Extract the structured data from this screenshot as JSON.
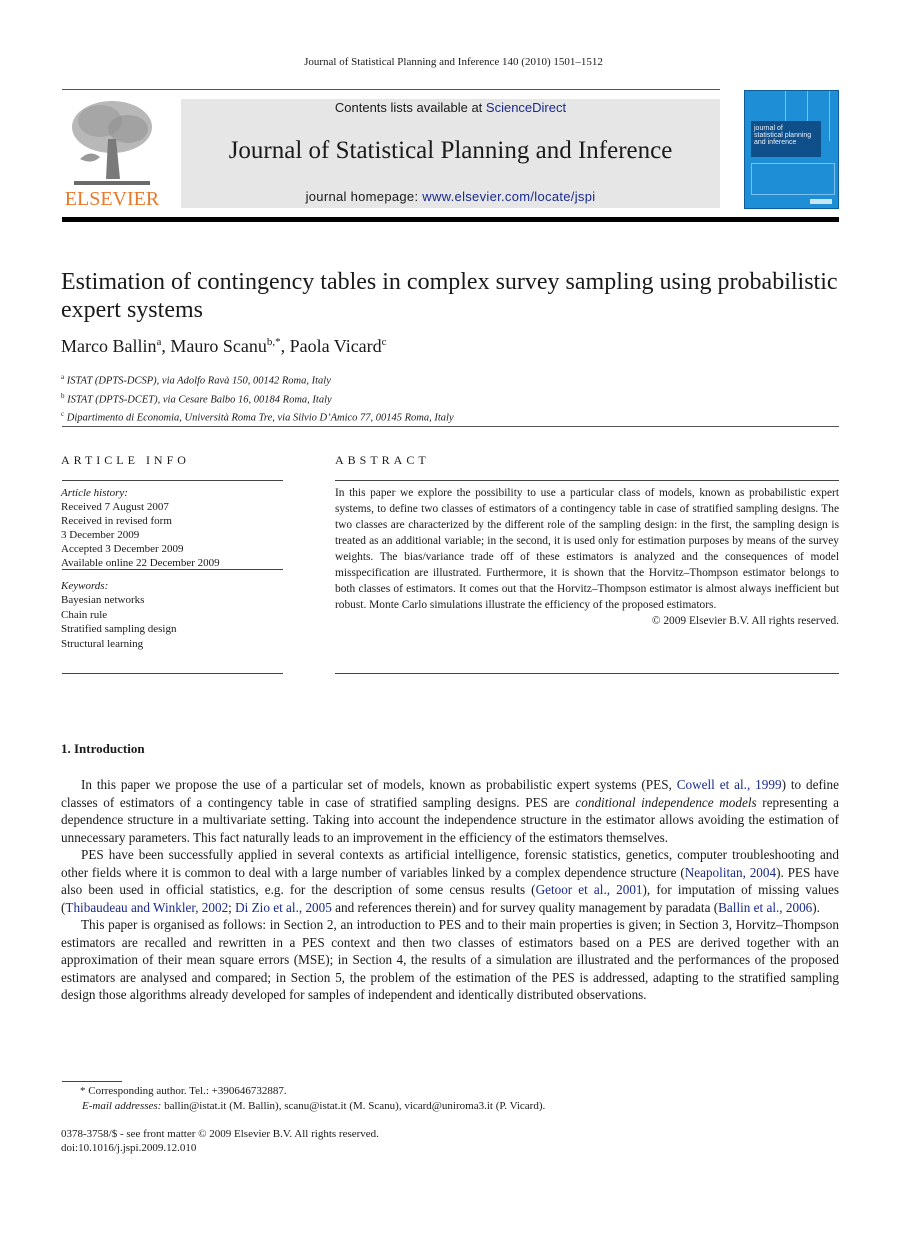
{
  "running_head": "Journal of Statistical Planning and Inference 140 (2010) 1501–1512",
  "masthead": {
    "publisher_logo_text": "ELSEVIER",
    "contents_prefix": "Contents lists available at ",
    "contents_link": "ScienceDirect",
    "journal_title": "Journal of Statistical Planning and Inference",
    "homepage_prefix": "journal homepage: ",
    "homepage_link": "www.elsevier.com/locate/jspi",
    "cover_text": [
      "journal of",
      "statistical planning",
      "and inference"
    ],
    "brand_colors": {
      "elsevier_orange": "#e8792b",
      "cover_blue": "#1e8fd6",
      "link_blue": "#1a2a8a"
    }
  },
  "article": {
    "title": "Estimation of contingency tables in complex survey sampling using probabilistic expert systems",
    "authors": [
      {
        "name": "Marco Ballin",
        "sup": "a"
      },
      {
        "name": "Mauro Scanu",
        "sup": "b,*"
      },
      {
        "name": "Paola Vicard",
        "sup": "c"
      }
    ],
    "affiliations": [
      {
        "sup": "a",
        "text": "ISTAT (DPTS-DCSP), via Adolfo Ravà 150, 00142 Roma, Italy"
      },
      {
        "sup": "b",
        "text": "ISTAT (DPTS-DCET), via Cesare Balbo 16, 00184 Roma, Italy"
      },
      {
        "sup": "c",
        "text": "Dipartimento di Economia, Università Roma Tre, via Silvio D’Amico 77, 00145 Roma, Italy"
      }
    ]
  },
  "article_info": {
    "heading": "ARTICLE INFO",
    "history_label": "Article history:",
    "history": [
      "Received 7 August 2007",
      "Received in revised form",
      "3 December 2009",
      "Accepted 3 December 2009",
      "Available online 22 December 2009"
    ],
    "keywords_label": "Keywords:",
    "keywords": [
      "Bayesian networks",
      "Chain rule",
      "Stratified sampling design",
      "Structural learning"
    ]
  },
  "abstract": {
    "heading": "ABSTRACT",
    "text": "In this paper we explore the possibility to use a particular class of models, known as probabilistic expert systems, to define two classes of estimators of a contingency table in case of stratified sampling designs. The two classes are characterized by the different role of the sampling design: in the first, the sampling design is treated as an additional variable; in the second, it is used only for estimation purposes by means of the survey weights. The bias/variance trade off of these estimators is analyzed and the consequences of model misspecification are illustrated. Furthermore, it is shown that the Horvitz–Thompson estimator belongs to both classes of estimators. It comes out that the Horvitz–Thompson estimator is almost always inefficient but robust. Monte Carlo simulations illustrate the efficiency of the proposed estimators.",
    "copyright": "© 2009 Elsevier B.V. All rights reserved."
  },
  "introduction": {
    "heading": "1.  Introduction",
    "p1": {
      "a": "In this paper we propose the use of a particular set of models, known as probabilistic expert systems (PES, ",
      "ref1": "Cowell et al., 1999",
      "b": ") to define classes of estimators of a contingency table in case of stratified sampling designs. PES are ",
      "em": "conditional independence models",
      "c": " representing a dependence structure in a multivariate setting. Taking into account the independence structure in the estimator allows avoiding the estimation of unnecessary parameters. This fact naturally leads to an improvement in the efficiency of the estimators themselves."
    },
    "p2": {
      "a": "PES have been successfully applied in several contexts as artificial intelligence, forensic statistics, genetics, computer troubleshooting and other fields where it is common to deal with a large number of variables linked by a complex dependence structure (",
      "ref1": "Neapolitan, 2004",
      "b": "). PES have also been used in official statistics, e.g. for the description of some census results (",
      "ref2": "Getoor et al., 2001",
      "c": "), for imputation of missing values (",
      "ref3": "Thibaudeau and Winkler, 2002",
      "d": "; ",
      "ref4": "Di Zio et al., 2005",
      "e": " and references therein) and for survey quality management by paradata (",
      "ref5": "Ballin et al., 2006",
      "f": ")."
    },
    "p3": "This paper is organised as follows: in Section 2, an introduction to PES and to their main properties is given; in Section 3, Horvitz–Thompson estimators are recalled and rewritten in a PES context and then two classes of estimators based on a PES are derived together with an approximation of their mean square errors (MSE); in Section 4, the results of a simulation are illustrated and the performances of the proposed estimators are analysed and compared; in Section 5, the problem of the estimation of the PES is addressed, adapting to the stratified sampling design those algorithms already developed for samples of independent and identically distributed observations."
  },
  "footnotes": {
    "corresponding": "* Corresponding author. Tel.: +390646732887.",
    "email_label": "E-mail addresses:",
    "emails": " ballin@istat.it (M. Ballin), scanu@istat.it (M. Scanu), vicard@uniroma3.it (P. Vicard)."
  },
  "front_matter": {
    "issn_line": "0378-3758/$ - see front matter © 2009 Elsevier B.V. All rights reserved.",
    "doi": "doi:10.1016/j.jspi.2009.12.010"
  }
}
